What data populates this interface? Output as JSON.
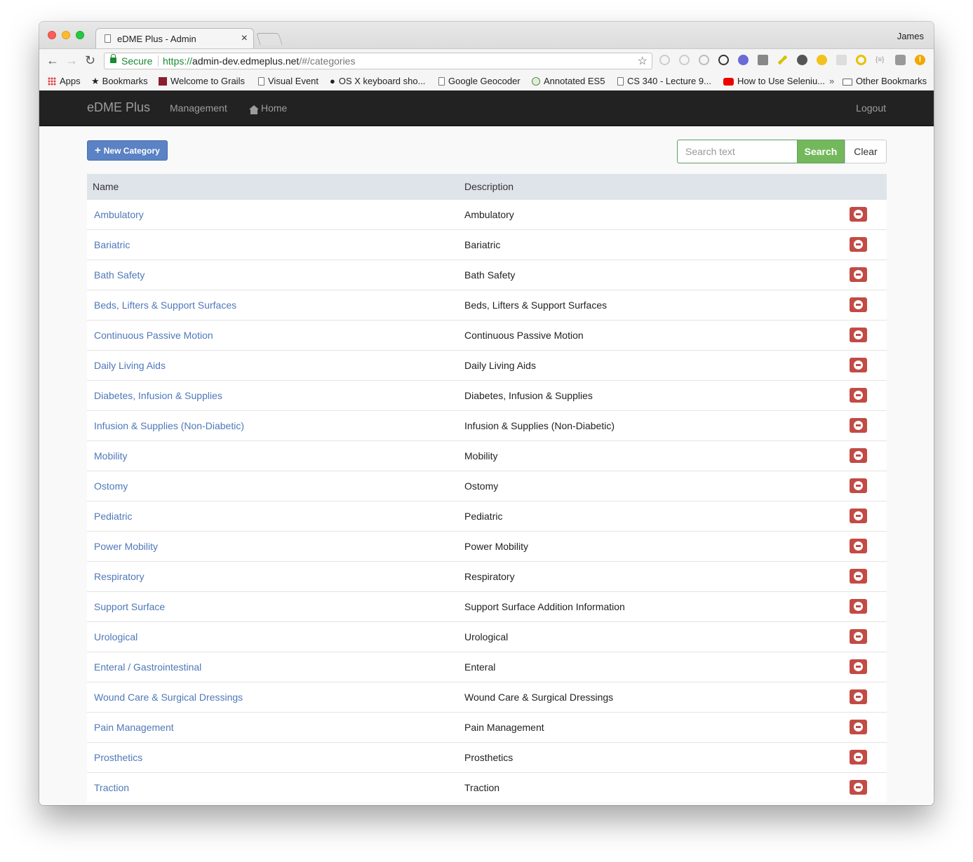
{
  "browser": {
    "tab_title": "eDME Plus - Admin",
    "profile_name": "James",
    "secure_label": "Secure",
    "url_scheme": "https://",
    "url_host": "admin-dev.edmeplus.net",
    "url_path": "/#/categories",
    "bookmarks": [
      "Apps",
      "Bookmarks",
      "Welcome to Grails",
      "Visual Event",
      "OS X keyboard sho...",
      "Google Geocoder",
      "Annotated ES5",
      "CS 340 - Lecture 9...",
      "How to Use Seleniu..."
    ],
    "bookmarks_overflow": "»",
    "other_bookmarks": "Other Bookmarks"
  },
  "navbar": {
    "brand": "eDME Plus",
    "management": "Management",
    "home": "Home",
    "logout": "Logout"
  },
  "toolbar": {
    "new_category_label": "New Category",
    "search_placeholder": "Search text",
    "search_label": "Search",
    "clear_label": "Clear"
  },
  "table": {
    "headers": {
      "name": "Name",
      "description": "Description"
    },
    "rows": [
      {
        "name": "Ambulatory",
        "description": "Ambulatory"
      },
      {
        "name": "Bariatric",
        "description": "Bariatric"
      },
      {
        "name": "Bath Safety",
        "description": "Bath Safety"
      },
      {
        "name": "Beds, Lifters & Support Surfaces",
        "description": "Beds, Lifters & Support Surfaces"
      },
      {
        "name": "Continuous Passive Motion",
        "description": "Continuous Passive Motion"
      },
      {
        "name": "Daily Living Aids",
        "description": "Daily Living Aids"
      },
      {
        "name": "Diabetes, Infusion & Supplies",
        "description": "Diabetes, Infusion & Supplies"
      },
      {
        "name": "Infusion & Supplies (Non-Diabetic)",
        "description": "Infusion & Supplies (Non-Diabetic)"
      },
      {
        "name": "Mobility",
        "description": "Mobility"
      },
      {
        "name": "Ostomy",
        "description": "Ostomy"
      },
      {
        "name": "Pediatric",
        "description": "Pediatric"
      },
      {
        "name": "Power Mobility",
        "description": "Power Mobility"
      },
      {
        "name": "Respiratory",
        "description": "Respiratory"
      },
      {
        "name": "Support Surface",
        "description": "Support Surface Addition Information"
      },
      {
        "name": "Urological",
        "description": "Urological"
      },
      {
        "name": "Enteral / Gastrointestinal",
        "description": "Enteral"
      },
      {
        "name": "Wound Care & Surgical Dressings",
        "description": "Wound Care & Surgical Dressings"
      },
      {
        "name": "Pain Management",
        "description": "Pain Management"
      },
      {
        "name": "Prosthetics",
        "description": "Prosthetics"
      },
      {
        "name": "Traction",
        "description": "Traction"
      }
    ]
  },
  "colors": {
    "navbar_bg": "#222222",
    "link": "#4f78b9",
    "primary_button": "#5a82c4",
    "search_button": "#74b85c",
    "delete_button": "#c24b45",
    "table_header": "#dfe3ea"
  }
}
